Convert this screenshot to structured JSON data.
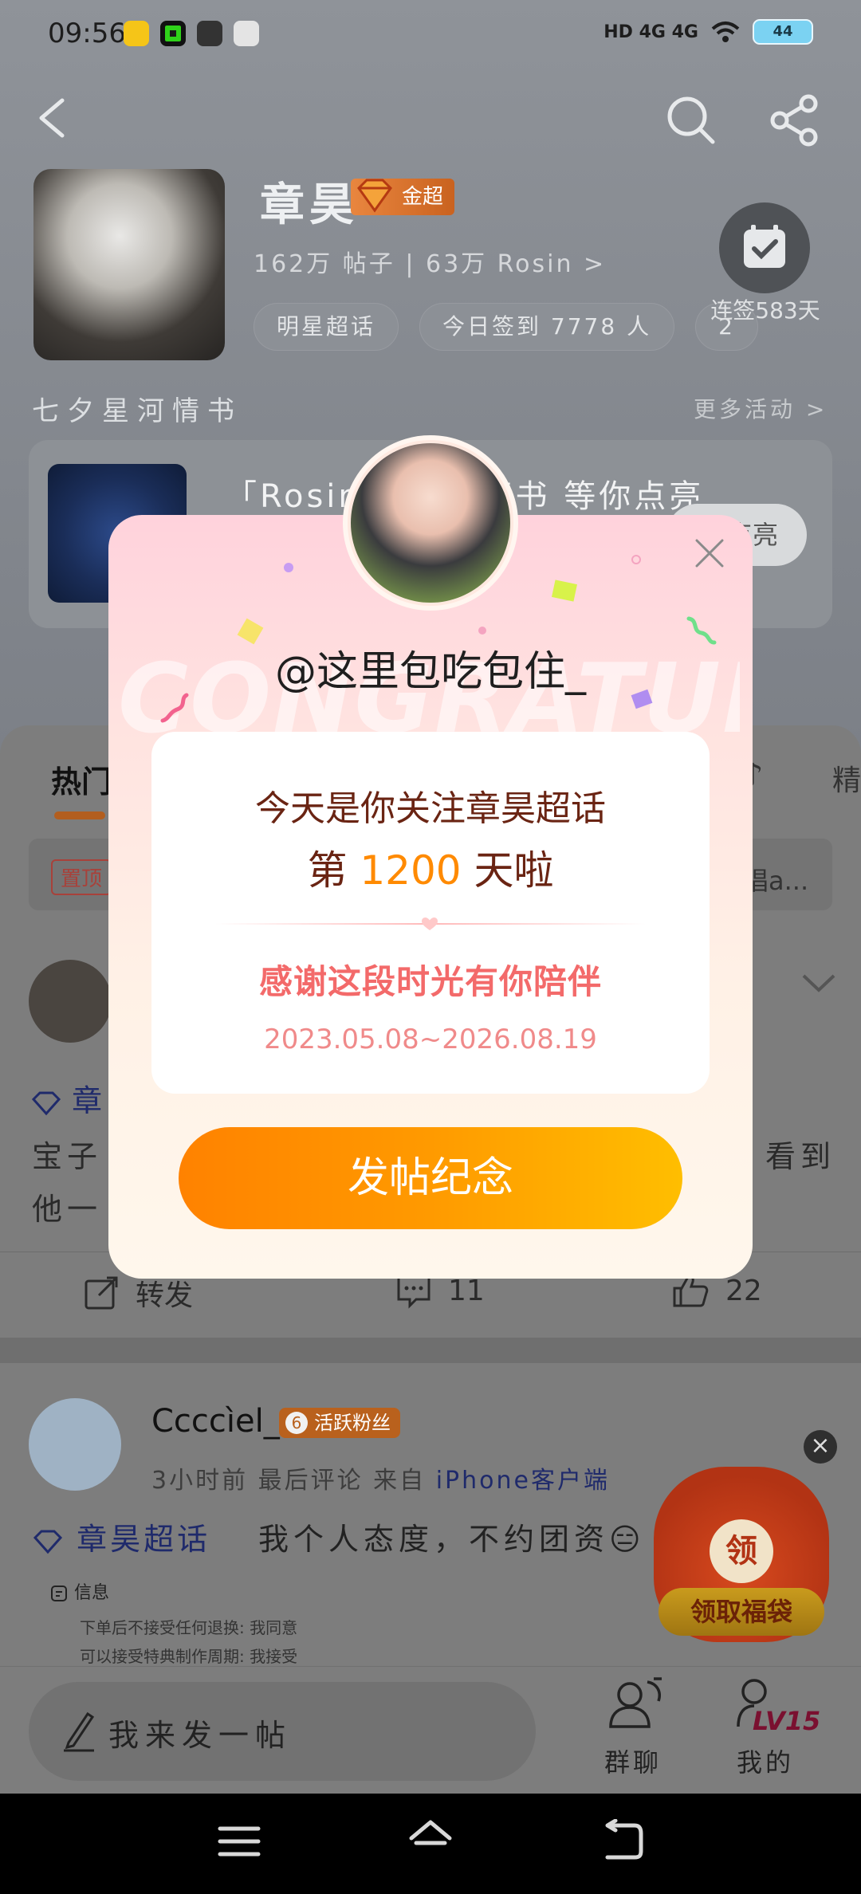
{
  "status_bar": {
    "time": "09:56",
    "network": "HD 4G 4G",
    "battery": "44"
  },
  "topic": {
    "title": "章昊",
    "badge": "金超",
    "stats": "162万 帖子 | 63万 Rosin >",
    "chips": [
      "明星超话",
      "今日签到 7778 人",
      "2"
    ],
    "signin_label": "连签583天"
  },
  "activity": {
    "section_title": "七夕星河情书",
    "more": "更多活动 >",
    "text": "「Rosin的 星河情书 等你点亮",
    "button": "点亮"
  },
  "feed": {
    "tab_hot": "热门",
    "tab_right": "精",
    "tab_music": "♪",
    "pinned": "置顶",
    "pinned_tail": "唱a...",
    "post1": {
      "topic": "章",
      "text1": "宝子",
      "text1_tail": "看到",
      "text2": "他一",
      "actions": {
        "repost": "转发",
        "comment": "11",
        "like": "22"
      }
    },
    "post2": {
      "name": "Ccccìel_",
      "fan_level": "6",
      "fan_badge": "活跃粉丝",
      "meta_time": "3小时前 最后评论 来自 ",
      "meta_client": "iPhone客户端",
      "topic": "章昊超话",
      "text": "我个人态度，不约团资😑",
      "info_title": "信息",
      "info_line1": "下单后不接受任何退换: 我同意",
      "info_line2": "可以接受特典制作周期: 我接受"
    }
  },
  "lucky_bag": {
    "circle": "领",
    "button": "领取福袋"
  },
  "bottom_bar": {
    "post_placeholder": "我来发一帖",
    "group": "群聊",
    "mine": "我的",
    "level": "LV15"
  },
  "modal": {
    "bg_text": "CONGRATULATE",
    "username": "@这里包吃包住_",
    "line1": "今天是你关注章昊超话",
    "line2_prefix": "第 ",
    "line2_days": "1200",
    "line2_suffix": " 天啦",
    "thanks": "感谢这段时光有你陪伴",
    "dates": "2023.05.08~2026.08.19",
    "button": "发帖纪念"
  },
  "colors": {
    "accent_orange": "#ff8a00",
    "thanks_pink": "#f36a6a",
    "title_brown": "#6a2413"
  }
}
